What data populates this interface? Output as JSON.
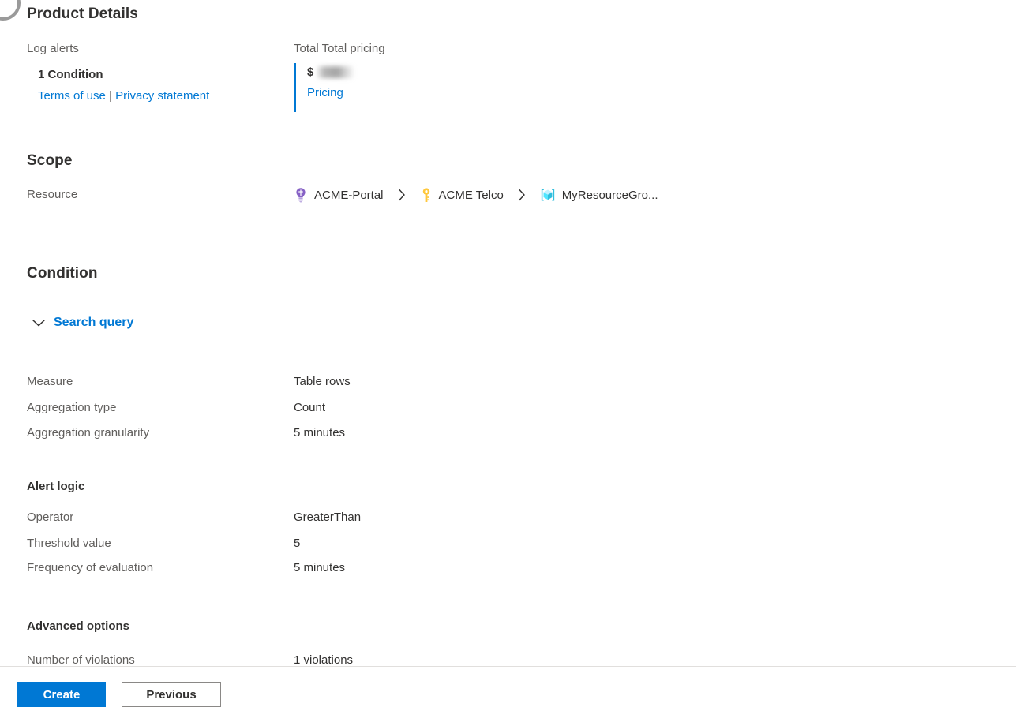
{
  "product_details": {
    "heading": "Product Details",
    "left": {
      "label": "Log alerts",
      "value": "1 Condition",
      "terms_link": "Terms of use",
      "separator": "|",
      "privacy_link": "Privacy statement"
    },
    "right": {
      "label": "Total Total pricing",
      "currency": "$",
      "amount": "",
      "pricing_link": "Pricing"
    }
  },
  "scope": {
    "heading": "Scope",
    "row_label": "Resource",
    "breadcrumb": [
      {
        "icon": "tenant-icon",
        "label": "ACME-Portal"
      },
      {
        "icon": "subscription-key-icon",
        "label": "ACME Telco"
      },
      {
        "icon": "resource-group-cube-icon",
        "label": "MyResourceGro..."
      }
    ],
    "separator_icon": "chevron-right-icon"
  },
  "condition": {
    "heading": "Condition",
    "search_query": {
      "title": "Search query",
      "chevron_icon": "chevron-down-icon"
    },
    "rows": [
      {
        "label": "Measure",
        "value": "Table rows"
      },
      {
        "label": "Aggregation type",
        "value": "Count"
      },
      {
        "label": "Aggregation granularity",
        "value": "5 minutes"
      }
    ]
  },
  "alert_logic": {
    "heading": "Alert logic",
    "rows": [
      {
        "label": "Operator",
        "value": "GreaterThan"
      },
      {
        "label": "Threshold value",
        "value": "5"
      },
      {
        "label": "Frequency of evaluation",
        "value": "5 minutes"
      }
    ]
  },
  "advanced_options": {
    "heading": "Advanced options",
    "rows": [
      {
        "label": "Number of violations",
        "value": "1 violations"
      }
    ]
  },
  "footer": {
    "create_label": "Create",
    "previous_label": "Previous"
  },
  "colors": {
    "accent": "#0078d4",
    "link": "#0078d4",
    "text": "#323130",
    "muted": "#605e5c",
    "divider": "#e1dfdd"
  }
}
